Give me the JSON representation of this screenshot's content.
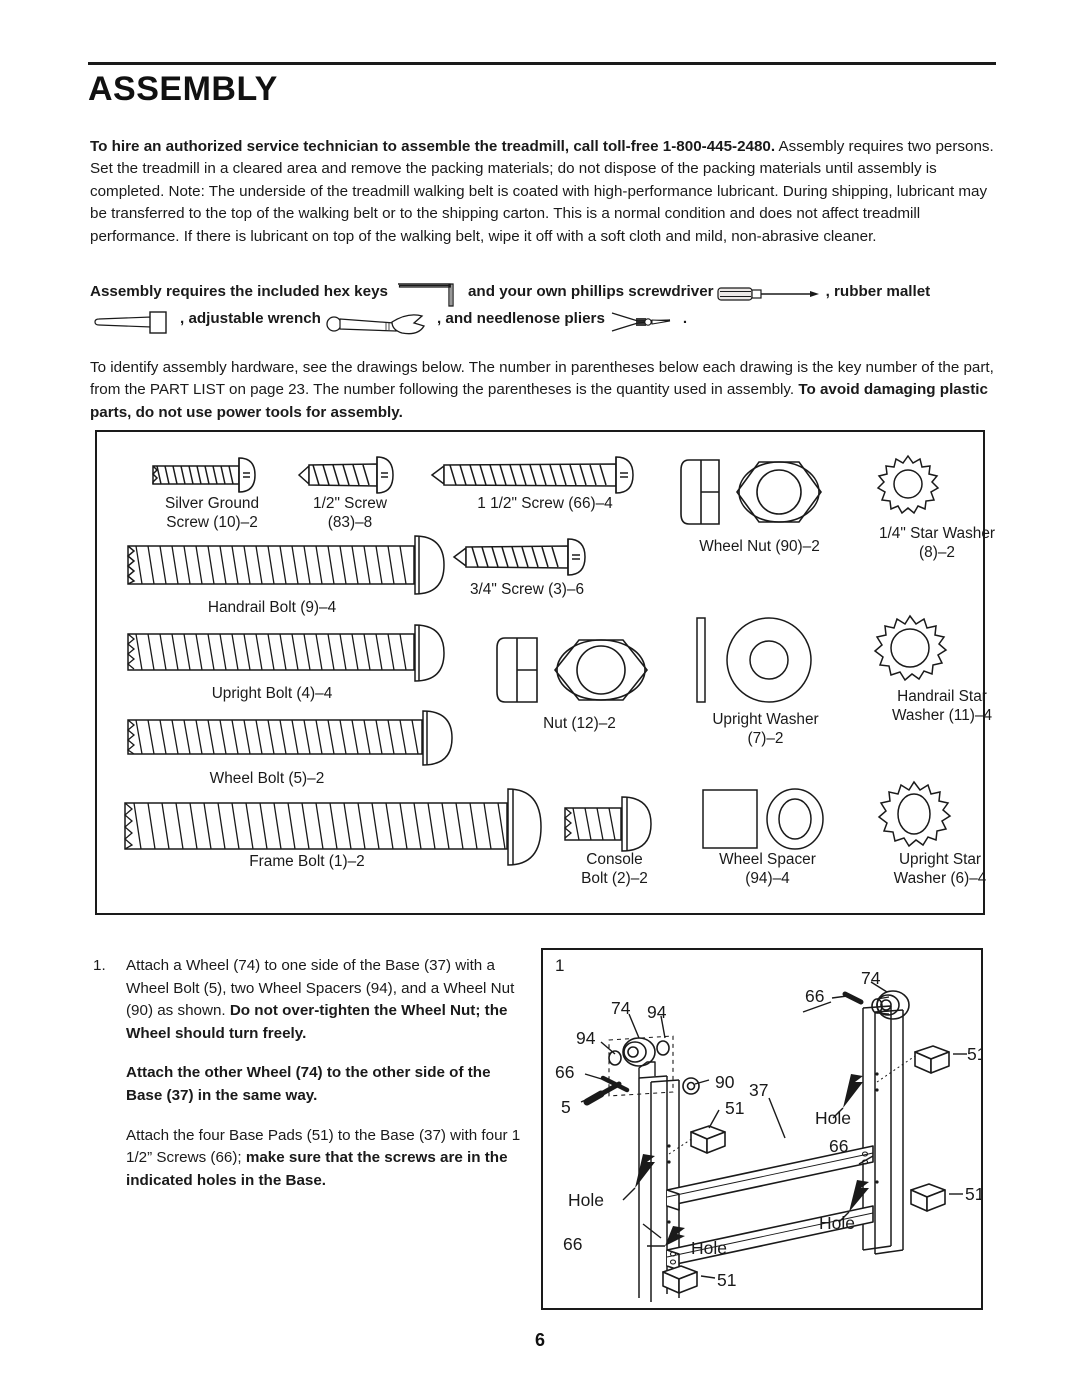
{
  "document": {
    "title": "ASSEMBLY",
    "page_number": "6"
  },
  "intro_paragraph": {
    "bold_lead": "To hire an authorized service technician to assemble the treadmill, call toll-free 1-800-445-2480.",
    "rest": " Assembly requires two persons. Set the treadmill in a cleared area and remove the packing materials; do not dispose of the packing materials until assembly is completed. Note: The underside of the treadmill walking belt is coated with high-performance lubricant. During shipping, lubricant may be transferred to the top of the walking belt or to the shipping carton. This is a normal condition and does not affect treadmill performance. If there is lubricant on top of the walking belt, wipe it off with a soft cloth and mild, non-abrasive cleaner."
  },
  "tools_paragraph": {
    "seg1": "Assembly requires the included hex keys",
    "seg2": "and your own phillips screwdriver",
    "seg3": ", rubber mallet",
    "seg4": ", adjustable wrench",
    "seg5": ", and needlenose pliers",
    "seg6": ".",
    "icons": {
      "hex_key": "hex-key-icon",
      "phillips_screwdriver": "phillips-screwdriver-icon",
      "rubber_mallet": "rubber-mallet-icon",
      "adjustable_wrench": "adjustable-wrench-icon",
      "needlenose_pliers": "needlenose-pliers-icon"
    }
  },
  "identify_paragraph": {
    "normal1": "To identify assembly hardware, see the drawings below. The number in parentheses below each drawing is the key number of the part, from the PART LIST on page 23. The number following the parentheses is the quantity used in assembly. ",
    "bold1": "To avoid damaging plastic parts, do not use power tools for assembly."
  },
  "hardware": {
    "parts": [
      {
        "name": "Silver Ground Screw",
        "key": "10",
        "qty": "2",
        "label": "Silver Ground\nScrew (10)–2",
        "art": "machine-screw"
      },
      {
        "name": "1/2\" Screw",
        "key": "83",
        "qty": "8",
        "label": "1/2\" Screw\n(83)–8",
        "art": "tapping-screw"
      },
      {
        "name": "1 1/2\" Screw",
        "key": "66",
        "qty": "4",
        "label": "1 1/2\" Screw (66)–4",
        "art": "tapping-screw-long"
      },
      {
        "name": "Wheel Nut",
        "key": "90",
        "qty": "2",
        "label": "Wheel Nut (90)–2",
        "art": "nut"
      },
      {
        "name": "1/4\" Star Washer",
        "key": "8",
        "qty": "2",
        "label": "1/4\" Star Washer\n(8)–2",
        "art": "star-washer-small"
      },
      {
        "name": "Handrail Bolt",
        "key": "9",
        "qty": "4",
        "label": "Handrail Bolt (9)–4",
        "art": "bolt-long"
      },
      {
        "name": "3/4\" Screw",
        "key": "3",
        "qty": "6",
        "label": "3/4\" Screw (3)–6",
        "art": "tapping-screw-med"
      },
      {
        "name": "Upright Bolt",
        "key": "4",
        "qty": "4",
        "label": "Upright Bolt (4)–4",
        "art": "bolt-long"
      },
      {
        "name": "Nut",
        "key": "12",
        "qty": "2",
        "label": "Nut (12)–2",
        "art": "nut"
      },
      {
        "name": "Upright Washer",
        "key": "7",
        "qty": "2",
        "label": "Upright Washer\n(7)–2",
        "art": "flat-washer"
      },
      {
        "name": "Handrail Star Washer",
        "key": "11",
        "qty": "4",
        "label": "Handrail Star\nWasher (11)–4",
        "art": "star-washer"
      },
      {
        "name": "Wheel Bolt",
        "key": "5",
        "qty": "2",
        "label": "Wheel Bolt (5)–2",
        "art": "bolt-long"
      },
      {
        "name": "Frame Bolt",
        "key": "1",
        "qty": "2",
        "label": "Frame Bolt (1)–2",
        "art": "bolt-extra-long"
      },
      {
        "name": "Console Bolt",
        "key": "2",
        "qty": "2",
        "label": "Console\nBolt (2)–2",
        "art": "bolt-short"
      },
      {
        "name": "Wheel Spacer",
        "key": "94",
        "qty": "4",
        "label": "Wheel Spacer\n(94)–4",
        "art": "spacer"
      },
      {
        "name": "Upright Star Washer",
        "key": "6",
        "qty": "4",
        "label": "Upright Star\nWasher (6)–4",
        "art": "star-washer-oval"
      }
    ]
  },
  "step": {
    "number": "1.",
    "paragraph1_normal1": "Attach a Wheel (74) to one side of the Base (37) with a Wheel Bolt (5), two Wheel Spacers (94), and a Wheel Nut (90) as shown. ",
    "paragraph1_bold": "Do not over-tighten the Wheel Nut; the Wheel should turn freely.",
    "paragraph2_bold": "Attach the other Wheel (74) to the other side of the Base (37) in the same way.",
    "paragraph3_normal": "Attach the four Base Pads (51) to the Base (37) with four 1 1/2” Screws (66); ",
    "paragraph3_bold": "make sure that the screws are in the indicated holes in the Base."
  },
  "figure": {
    "number": "1",
    "callouts": [
      {
        "text": "74",
        "role": "wheel"
      },
      {
        "text": "94",
        "role": "wheel-spacer"
      },
      {
        "text": "94",
        "role": "wheel-spacer"
      },
      {
        "text": "66",
        "role": "screw"
      },
      {
        "text": "5",
        "role": "wheel-bolt"
      },
      {
        "text": "90",
        "role": "wheel-nut"
      },
      {
        "text": "51",
        "role": "base-pad"
      },
      {
        "text": "Hole",
        "role": "hole-indicator"
      },
      {
        "text": "74",
        "role": "wheel"
      },
      {
        "text": "66",
        "role": "screw"
      },
      {
        "text": "Hole",
        "role": "hole-indicator"
      },
      {
        "text": "51",
        "role": "base-pad"
      },
      {
        "text": "37",
        "role": "base"
      },
      {
        "text": "66",
        "role": "screw"
      },
      {
        "text": "Hole",
        "role": "hole-indicator"
      },
      {
        "text": "51",
        "role": "base-pad"
      },
      {
        "text": "66",
        "role": "screw"
      },
      {
        "text": "Hole",
        "role": "hole-indicator"
      },
      {
        "text": "51",
        "role": "base-pad"
      }
    ]
  }
}
